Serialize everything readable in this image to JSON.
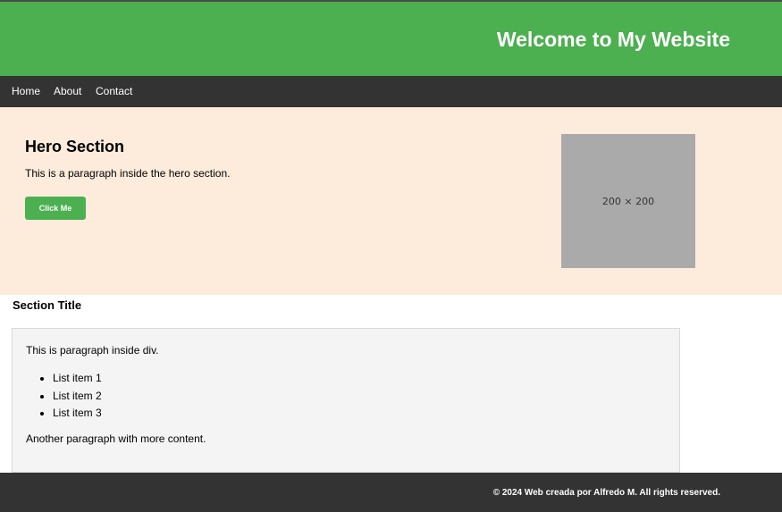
{
  "header": {
    "title": "Welcome to My Website"
  },
  "nav": {
    "items": [
      {
        "label": "Home"
      },
      {
        "label": "About"
      },
      {
        "label": "Contact"
      }
    ]
  },
  "hero": {
    "title": "Hero Section",
    "text": "This is a paragraph inside the hero section.",
    "button_label": "Click Me",
    "image_placeholder": "200 × 200"
  },
  "section": {
    "title": "Section Title",
    "paragraph_1": "This is paragraph inside div.",
    "list_items": [
      "List item 1",
      "List item 2",
      "List item 3"
    ],
    "paragraph_2": "Another paragraph with more content."
  },
  "footer": {
    "text": "© 2024 Web creada por Alfredo M. All rights reserved."
  },
  "colors": {
    "header_bg": "#4caf50",
    "nav_bg": "#333333",
    "hero_bg": "#fdebdb",
    "button_bg": "#4caf50",
    "content_bg": "#f4f4f4",
    "footer_bg": "#333333"
  }
}
